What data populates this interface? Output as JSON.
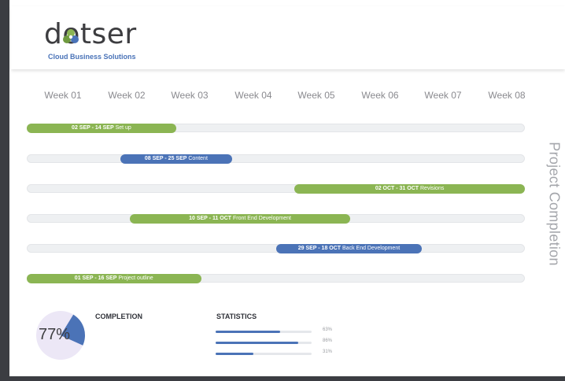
{
  "brand": {
    "name": "dotser",
    "tagline": "Cloud Business Solutions"
  },
  "weeks": [
    "Week 01",
    "Week 02",
    "Week 03",
    "Week 04",
    "Week 05",
    "Week 06",
    "Week 07",
    "Week 08"
  ],
  "tasks": [
    {
      "dates": "02 SEP - 14 SEP",
      "name": "Set up",
      "color": "#8bb553",
      "start_week": 0,
      "end_week": 2.4
    },
    {
      "dates": "08 SEP - 25 SEP",
      "name": "Content",
      "color": "#4b73b7",
      "start_week": 1.5,
      "end_week": 3.3
    },
    {
      "dates": "02 OCT - 31 OCT",
      "name": "Revisions",
      "color": "#8bb553",
      "start_week": 4.3,
      "end_week": 8.0
    },
    {
      "dates": "10 SEP - 11 OCT",
      "name": "Front End Development",
      "color": "#8bb553",
      "start_week": 1.65,
      "end_week": 5.2
    },
    {
      "dates": "29 SEP - 18 OCT",
      "name": "Back End Development",
      "color": "#4b73b7",
      "start_week": 4.0,
      "end_week": 6.35
    },
    {
      "dates": "01 SEP - 16 SEP",
      "name": "Project outline",
      "color": "#8bb553",
      "start_week": 0,
      "end_week": 2.8
    }
  ],
  "side_title": "Project Completion",
  "completion": {
    "title": "COMPLETION",
    "value_label": "77%",
    "fraction": 0.77
  },
  "statistics": {
    "title": "STATISTICS",
    "items": [
      {
        "label": "63%",
        "fraction": 0.67
      },
      {
        "label": "86%",
        "fraction": 0.86
      },
      {
        "label": "31%",
        "fraction": 0.39
      }
    ]
  },
  "colors": {
    "green": "#8bb553",
    "blue": "#4b73b7",
    "rail": "#3b3d42"
  }
}
